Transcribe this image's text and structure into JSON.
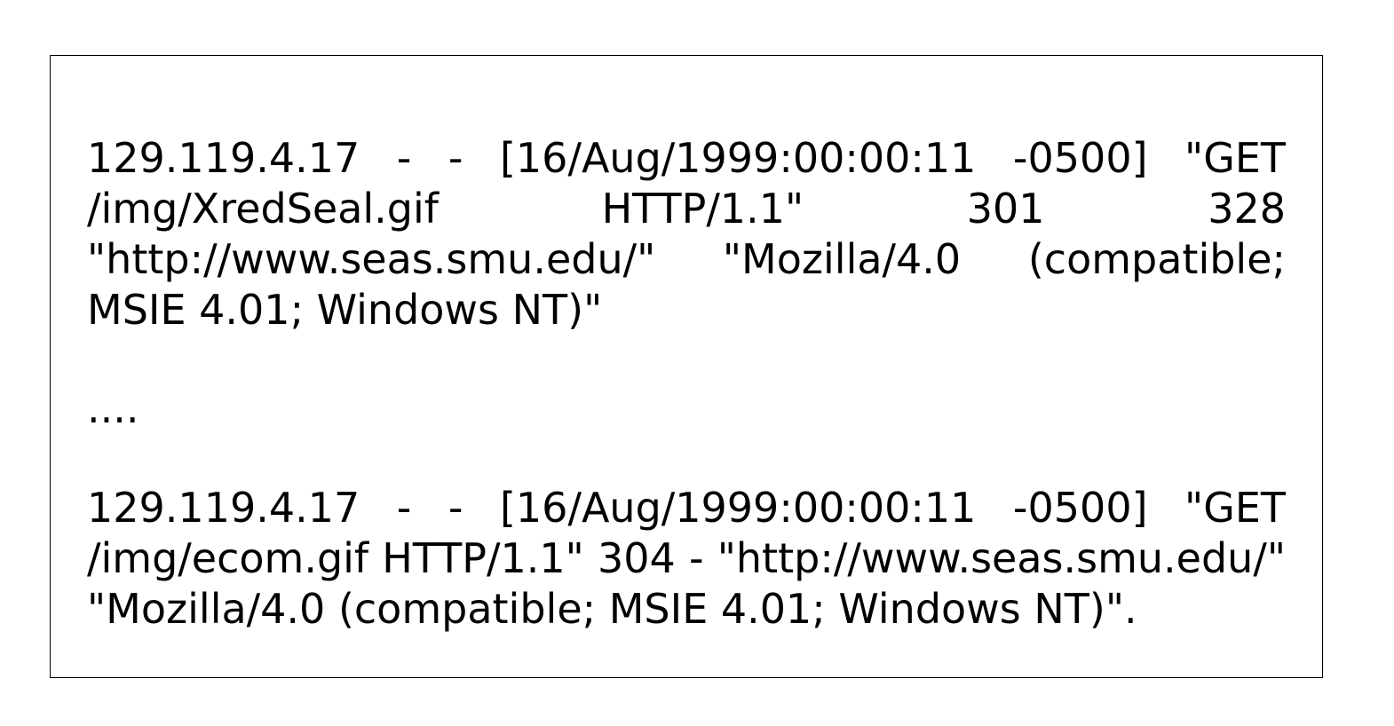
{
  "log_entries": [
    {
      "text": "129.119.4.17 - - [16/Aug/1999:00:00:11 -0500] \"GET /img/XredSeal.gif HTTP/1.1\" 301 328 \"http://www.seas.smu.edu/\" \"Mozilla/4.0 (compat­ible; MSIE 4.01; Windows NT)\""
    },
    {
      "text": "129.119.4.17 - - [16/Aug/1999:00:00:11 -0500] \"GET /img/ecom.gif HTTP/1.1\" 304 - \"http://www.seas.smu.edu/\" \"Mozilla/4.0 (compat­ible; MSIE 4.01; Windows NT)\"."
    }
  ],
  "separator": "...."
}
